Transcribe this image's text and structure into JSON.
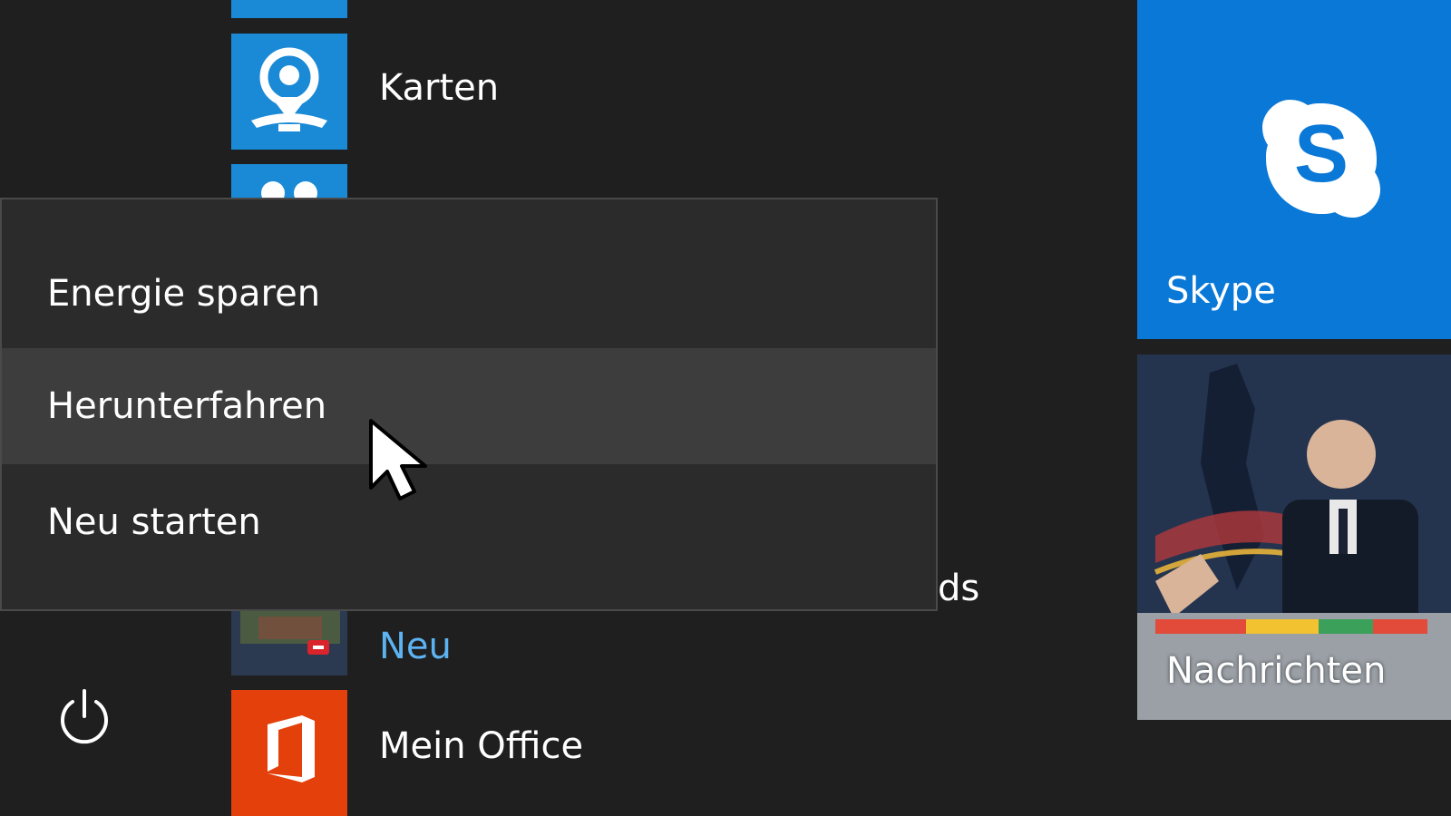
{
  "app_list": {
    "items": [
      {
        "label": "Karten",
        "icon": "map-pin-icon",
        "tile_color": "#1a8ad6"
      },
      {
        "label": "Neu",
        "icon": "news-thumbnail-icon",
        "label_color": "#5db3f1"
      },
      {
        "label": "Mein Office",
        "icon": "office-icon",
        "tile_color": "#e3400c"
      }
    ],
    "partial_label": "ds"
  },
  "power_menu": {
    "items": [
      {
        "label": "Energie sparen"
      },
      {
        "label": "Herunterfahren",
        "state": "hover"
      },
      {
        "label": "Neu starten"
      }
    ]
  },
  "power_button": {
    "icon": "power-icon"
  },
  "tiles": {
    "skype": {
      "label": "Skype",
      "icon": "skype-icon",
      "color": "#0a78d7"
    },
    "news": {
      "label": "Nachrichten",
      "icon": "news-photo"
    }
  },
  "cursor": {
    "icon": "mouse-pointer-icon"
  }
}
